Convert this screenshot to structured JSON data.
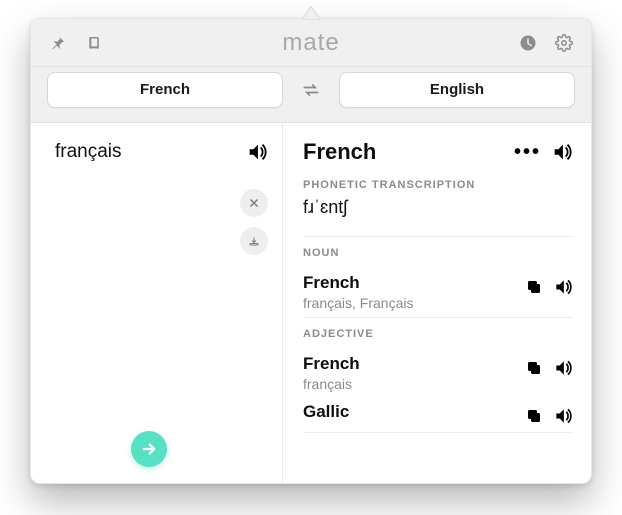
{
  "brand": "mate",
  "lang": {
    "source": "French",
    "target": "English"
  },
  "source_text": "français",
  "result": {
    "headword": "French",
    "phonetic_label": "PHONETIC TRANSCRIPTION",
    "phonetic": "fɹˈɛntʃ",
    "groups": [
      {
        "pos_label": "NOUN",
        "entries": [
          {
            "word": "French",
            "subs": "français, Français"
          }
        ]
      },
      {
        "pos_label": "ADJECTIVE",
        "entries": [
          {
            "word": "French",
            "subs": "français"
          },
          {
            "word": "Gallic",
            "subs": ""
          }
        ]
      }
    ]
  }
}
